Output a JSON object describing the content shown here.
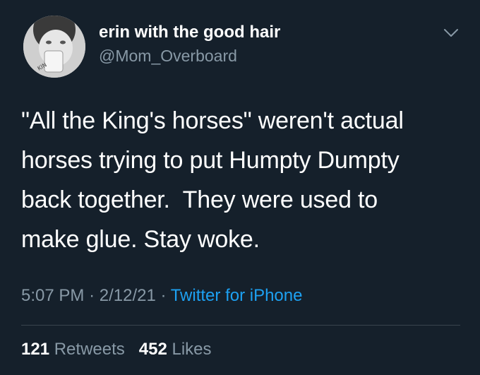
{
  "author": {
    "name": "erin with the good hair",
    "handle": "@Mom_Overboard",
    "avatar_icon": "profile-photo-avatar"
  },
  "menu_icon": "chevron-down-icon",
  "tweet": {
    "lines": [
      "\"All the King's horses\" weren't actual",
      "horses trying to put Humpty Dumpty",
      "back together.  They were used to",
      "make glue. Stay woke."
    ]
  },
  "meta": {
    "time": "5:07 PM",
    "separator": "·",
    "date": "2/12/21",
    "source": "Twitter for iPhone"
  },
  "stats": {
    "retweets_count": "121",
    "retweets_label": "Retweets",
    "likes_count": "452",
    "likes_label": "Likes"
  },
  "colors": {
    "background": "#15202b",
    "text_primary": "#ffffff",
    "text_secondary": "#8899a6",
    "accent": "#1da1f2",
    "divider": "#38444d"
  }
}
